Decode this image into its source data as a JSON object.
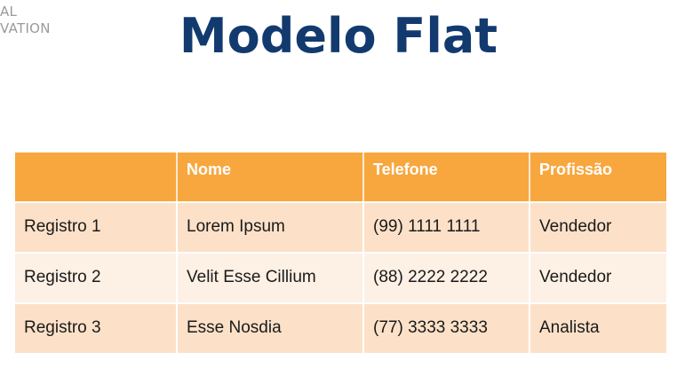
{
  "corner": {
    "line1": "AL",
    "line2": "VATION"
  },
  "title": "Modelo Flat",
  "table": {
    "headers": [
      "",
      "Nome",
      "Telefone",
      "Profissão"
    ],
    "rows": [
      [
        "Registro 1",
        "Lorem Ipsum",
        "(99) 1111 1111",
        "Vendedor"
      ],
      [
        "Registro 2",
        "Velit Esse Cillium",
        "(88) 2222 2222",
        "Vendedor"
      ],
      [
        "Registro 3",
        "Esse Nosdia",
        "(77) 3333 3333",
        "Analista"
      ]
    ]
  },
  "colors": {
    "title": "#123a6f",
    "header_bg": "#f8a73e",
    "row_dark": "#fce1c8",
    "row_light": "#fdf0e5"
  }
}
